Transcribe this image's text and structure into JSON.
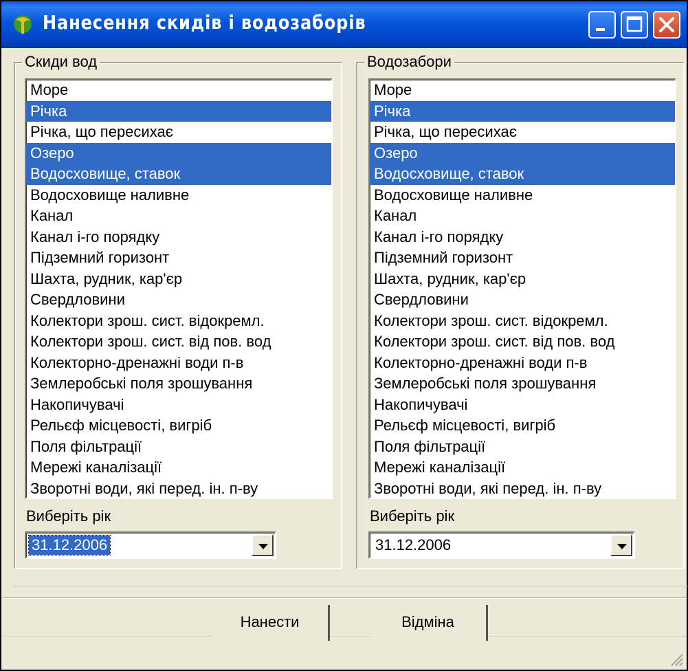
{
  "window": {
    "title": "Нанесення скидів і водозаборів",
    "controls": [
      "minimize",
      "maximize",
      "close"
    ]
  },
  "discharges": {
    "caption": "Скиди вод",
    "items": [
      {
        "label": "Море",
        "selected": false
      },
      {
        "label": "Річка",
        "selected": true
      },
      {
        "label": "Річка, що пересихає",
        "selected": false
      },
      {
        "label": "Озеро",
        "selected": true
      },
      {
        "label": "Водосховище, ставок",
        "selected": true
      },
      {
        "label": "Водосховище наливне",
        "selected": false
      },
      {
        "label": "Канал",
        "selected": false
      },
      {
        "label": "Канал і-го порядку",
        "selected": false
      },
      {
        "label": "Підземний горизонт",
        "selected": false
      },
      {
        "label": "Шахта, рудник, кар'єр",
        "selected": false
      },
      {
        "label": "Свердловини",
        "selected": false
      },
      {
        "label": "Колектори зрош. сист. відокремл.",
        "selected": false
      },
      {
        "label": "Колектори зрош. сист. від пов. вод",
        "selected": false
      },
      {
        "label": "Колекторно-дренажні води п-в",
        "selected": false
      },
      {
        "label": "Землеробські поля зрошування",
        "selected": false
      },
      {
        "label": "Накопичувачі",
        "selected": false
      },
      {
        "label": "Рельєф місцевості, вигріб",
        "selected": false
      },
      {
        "label": "Поля фільтрації",
        "selected": false
      },
      {
        "label": "Мережі каналізації",
        "selected": false
      },
      {
        "label": "Зворотні води, які перед. ін. п-ву",
        "selected": false
      }
    ],
    "year_label": "Виберіть рік",
    "year_value": "31.12.2006"
  },
  "intakes": {
    "caption": "Водозабори",
    "items": [
      {
        "label": "Море",
        "selected": false
      },
      {
        "label": "Річка",
        "selected": true
      },
      {
        "label": "Річка, що пересихає",
        "selected": false
      },
      {
        "label": "Озеро",
        "selected": true
      },
      {
        "label": "Водосховище, ставок",
        "selected": true
      },
      {
        "label": "Водосховище наливне",
        "selected": false
      },
      {
        "label": "Канал",
        "selected": false
      },
      {
        "label": "Канал і-го порядку",
        "selected": false
      },
      {
        "label": "Підземний горизонт",
        "selected": false
      },
      {
        "label": "Шахта, рудник, кар'єр",
        "selected": false
      },
      {
        "label": "Свердловини",
        "selected": false
      },
      {
        "label": "Колектори зрош. сист. відокремл.",
        "selected": false
      },
      {
        "label": "Колектори зрош. сист. від пов. вод",
        "selected": false
      },
      {
        "label": "Колекторно-дренажні води п-в",
        "selected": false
      },
      {
        "label": "Землеробські поля зрошування",
        "selected": false
      },
      {
        "label": "Накопичувачі",
        "selected": false
      },
      {
        "label": "Рельєф місцевості, вигріб",
        "selected": false
      },
      {
        "label": "Поля фільтрації",
        "selected": false
      },
      {
        "label": "Мережі каналізації",
        "selected": false
      },
      {
        "label": "Зворотні води, які перед. ін. п-ву",
        "selected": false
      }
    ],
    "year_label": "Виберіть рік",
    "year_value": "31.12.2006"
  },
  "buttons": {
    "apply": "Нанести",
    "cancel": "Відміна"
  },
  "colors": {
    "titlebar": "#0554d8",
    "selection": "#316ac5",
    "face": "#ece9d8"
  }
}
